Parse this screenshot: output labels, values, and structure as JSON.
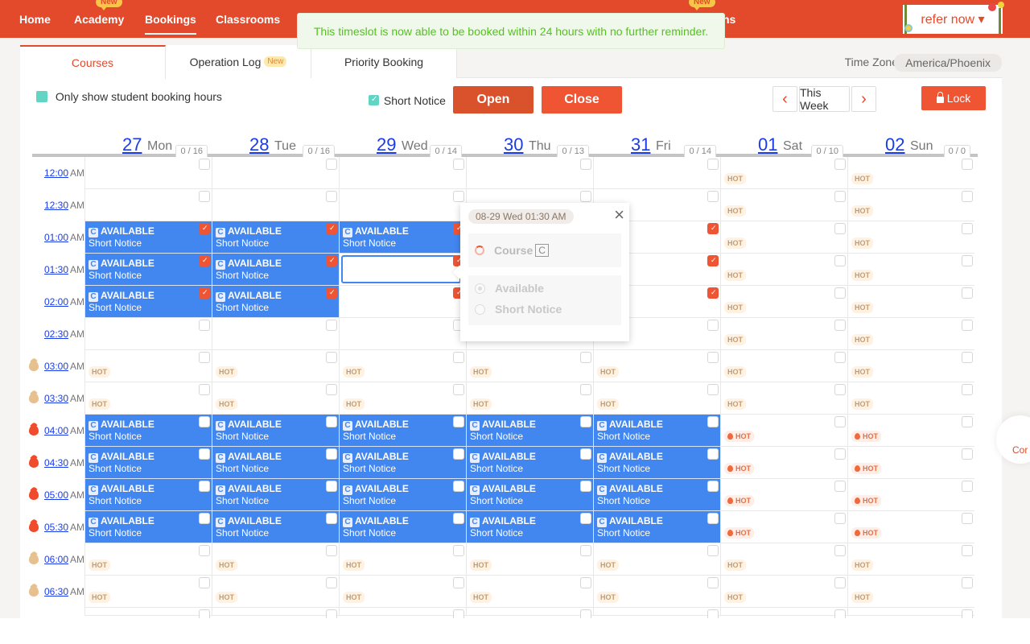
{
  "nav": {
    "items": [
      {
        "label": "Home",
        "active": false,
        "new": false
      },
      {
        "label": "Academy",
        "active": false,
        "new": true
      },
      {
        "label": "Bookings",
        "active": true,
        "new": false
      },
      {
        "label": "Classrooms",
        "active": false,
        "new": false
      }
    ],
    "hidden_item_suffix": "ns",
    "new_label": "New",
    "refer_label": "refer now ▾"
  },
  "toast": {
    "message": "This timeslot is now able to be booked within 24 hours with no further reminder."
  },
  "tabs": [
    {
      "label": "Courses",
      "active": true
    },
    {
      "label": "Operation Log",
      "badge": "New"
    },
    {
      "label": "Priority Booking"
    }
  ],
  "timezone": {
    "label": "Time Zone",
    "value": "America/Phoenix"
  },
  "toolbar": {
    "only_show_label": "Only show student booking hours",
    "short_notice_label": "Short Notice",
    "open_label": "Open",
    "close_label": "Close",
    "prev_icon": "‹",
    "this_week_label": "This Week",
    "next_icon": "›",
    "lock_label": "Lock"
  },
  "days": [
    {
      "num": "27",
      "name": "Mon",
      "count": "0 / 16"
    },
    {
      "num": "28",
      "name": "Tue",
      "count": "0 / 16"
    },
    {
      "num": "29",
      "name": "Wed",
      "count": "0 / 14"
    },
    {
      "num": "30",
      "name": "Thu",
      "count": "0 / 13"
    },
    {
      "num": "31",
      "name": "Fri",
      "count": "0 / 14"
    },
    {
      "num": "01",
      "name": "Sat",
      "count": "0 / 10"
    },
    {
      "num": "02",
      "name": "Sun",
      "count": "0 / 0"
    }
  ],
  "slot_text": {
    "title": "AVAILABLE",
    "sub": "Short Notice",
    "badge": "C",
    "hot": "HOT",
    "ampm": "AM"
  },
  "rows": [
    {
      "time": "12:00",
      "flame": "",
      "cells": [
        "e",
        "e",
        "e",
        "e",
        "e",
        "m",
        "m"
      ]
    },
    {
      "time": "12:30",
      "flame": "",
      "cells": [
        "e",
        "e",
        "e",
        "e",
        "e",
        "m",
        "m"
      ]
    },
    {
      "time": "01:00",
      "flame": "",
      "cells": [
        "AC",
        "AC",
        "AC",
        "C",
        "C",
        "m",
        "m"
      ]
    },
    {
      "time": "01:30",
      "flame": "",
      "cells": [
        "AC",
        "AC",
        "S",
        "C",
        "C",
        "m",
        "m"
      ]
    },
    {
      "time": "02:00",
      "flame": "",
      "cells": [
        "AC",
        "AC",
        "C",
        "C",
        "C",
        "m",
        "m"
      ]
    },
    {
      "time": "02:30",
      "flame": "",
      "cells": [
        "e",
        "e",
        "e",
        "e",
        "e",
        "m",
        "m"
      ]
    },
    {
      "time": "03:00",
      "flame": "mild",
      "cells": [
        "m",
        "m",
        "m",
        "m",
        "m",
        "m",
        "m"
      ]
    },
    {
      "time": "03:30",
      "flame": "mild",
      "cells": [
        "m",
        "m",
        "m",
        "m",
        "m",
        "m",
        "m"
      ]
    },
    {
      "time": "04:00",
      "flame": "hot",
      "cells": [
        "A",
        "A",
        "A",
        "A",
        "A",
        "h",
        "h"
      ]
    },
    {
      "time": "04:30",
      "flame": "hot",
      "cells": [
        "A",
        "A",
        "A",
        "A",
        "A",
        "h",
        "h"
      ]
    },
    {
      "time": "05:00",
      "flame": "hot",
      "cells": [
        "A",
        "A",
        "A",
        "A",
        "A",
        "h",
        "h"
      ]
    },
    {
      "time": "05:30",
      "flame": "hot",
      "cells": [
        "A",
        "A",
        "A",
        "A",
        "A",
        "h",
        "h"
      ]
    },
    {
      "time": "06:00",
      "flame": "mild",
      "cells": [
        "m",
        "m",
        "m",
        "m",
        "m",
        "m",
        "m"
      ]
    },
    {
      "time": "06:30",
      "flame": "mild",
      "cells": [
        "m",
        "m",
        "m",
        "m",
        "m",
        "m",
        "m"
      ]
    },
    {
      "time": "",
      "flame": "",
      "cells": [
        "e",
        "e",
        "e",
        "e",
        "e",
        "e",
        "e"
      ]
    }
  ],
  "popover": {
    "date": "08-29 Wed 01:30 AM",
    "close_icon": "×",
    "course_label": "Course",
    "course_badge": "C",
    "options": [
      {
        "label": "Available",
        "selected": true
      },
      {
        "label": "Short Notice",
        "selected": false
      }
    ]
  },
  "contact_fab": {
    "label": "Cor"
  }
}
